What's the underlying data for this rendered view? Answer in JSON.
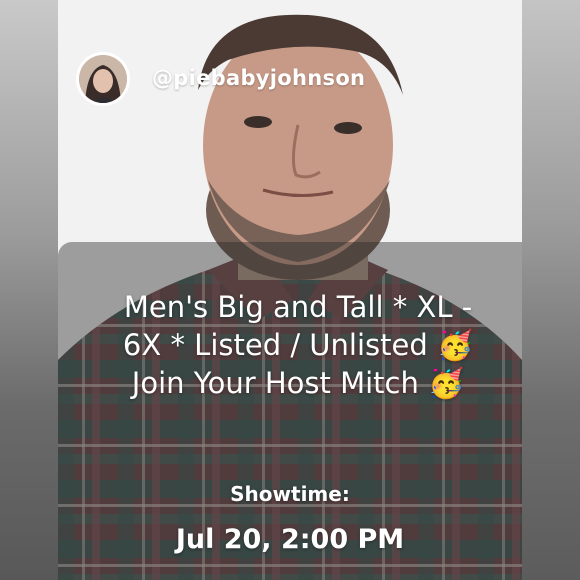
{
  "host": {
    "username": "@piebabyjohnson",
    "avatar_icon": "avatar-icon"
  },
  "show": {
    "title_lines": [
      "Men's Big and Tall * XL -",
      "6X * Listed / Unlisted 🥳",
      "Join Your Host Mitch 🥳"
    ],
    "showtime_label": "Showtime:",
    "showtime_value": "Jul 20, 2:00 PM"
  },
  "colors": {
    "text": "#ffffff",
    "overlay": "#3a3a3a",
    "background": "#f2f2f2"
  }
}
